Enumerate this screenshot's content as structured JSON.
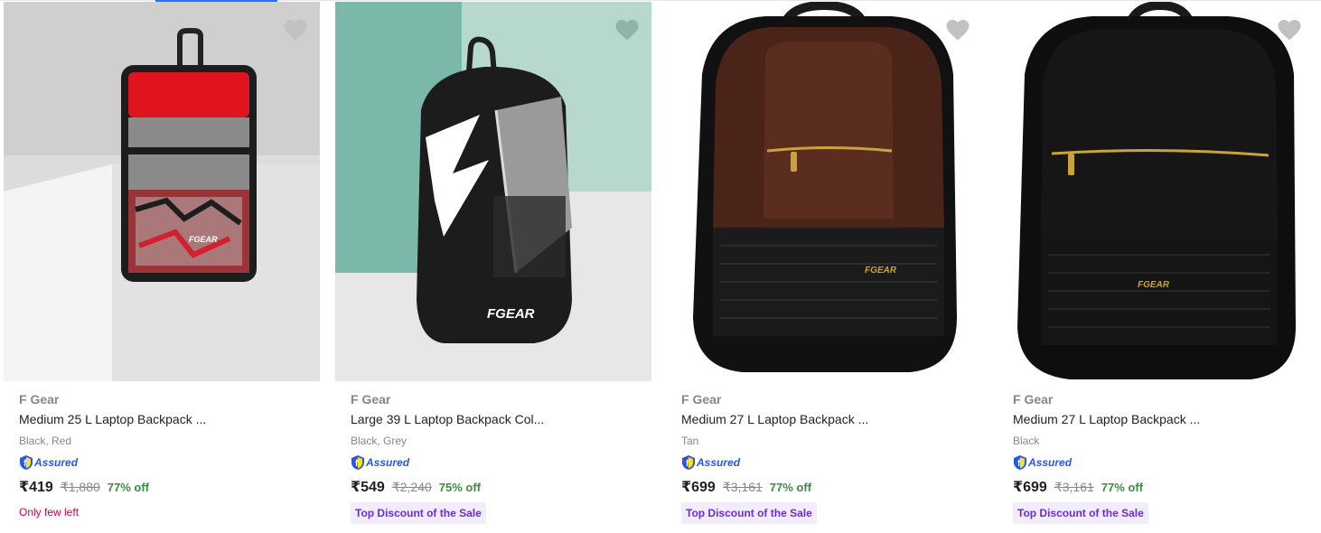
{
  "colors": {
    "accent": "#2874f0",
    "brand_text": "#878787",
    "discount_green": "#388e3c",
    "few_left": "#c70055",
    "sale_tag_bg": "#f1edfc",
    "sale_tag_text": "#6a2ed8",
    "wishlist": "#c2c2c2"
  },
  "products": [
    {
      "brand": "F Gear",
      "title": "Medium 25 L Laptop Backpack ...",
      "variant": "Black, Red",
      "assured": "Assured",
      "price": "₹419",
      "mrp": "₹1,880",
      "discount": "77% off",
      "tag": "Only few left",
      "tag_style": "few",
      "image_icon": "backpack-red-grey-image",
      "logo_text": "FGEAR"
    },
    {
      "brand": "F Gear",
      "title": "Large 39 L Laptop Backpack Col...",
      "variant": "Black, Grey",
      "assured": "Assured",
      "price": "₹549",
      "mrp": "₹2,240",
      "discount": "75% off",
      "tag": "Top Discount of the Sale",
      "tag_style": "sale",
      "image_icon": "backpack-black-grey-image",
      "logo_text": "FGEAR"
    },
    {
      "brand": "F Gear",
      "title": "Medium 27 L Laptop Backpack ...",
      "variant": "Tan",
      "assured": "Assured",
      "price": "₹699",
      "mrp": "₹3,161",
      "discount": "77% off",
      "tag": "Top Discount of the Sale",
      "tag_style": "sale",
      "image_icon": "backpack-brown-leather-image",
      "logo_text": "FGEAR"
    },
    {
      "brand": "F Gear",
      "title": "Medium 27 L Laptop Backpack ...",
      "variant": "Black",
      "assured": "Assured",
      "price": "₹699",
      "mrp": "₹3,161",
      "discount": "77% off",
      "tag": "Top Discount of the Sale",
      "tag_style": "sale",
      "image_icon": "backpack-black-leather-image",
      "logo_text": "FGEAR"
    }
  ]
}
